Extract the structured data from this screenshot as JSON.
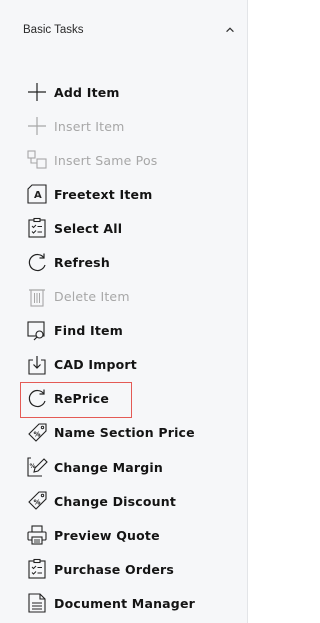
{
  "panel": {
    "title": "Basic Tasks",
    "collapse_icon": "chevron-up-icon"
  },
  "items": [
    {
      "label": "Add Item",
      "icon": "plus-icon",
      "enabled": true
    },
    {
      "label": "Insert Item",
      "icon": "plus-icon",
      "enabled": false
    },
    {
      "label": "Insert Same Pos",
      "icon": "insert-same-pos-icon",
      "enabled": false
    },
    {
      "label": "Freetext Item",
      "icon": "freetext-icon",
      "enabled": true
    },
    {
      "label": "Select All",
      "icon": "checklist-clipboard-icon",
      "enabled": true
    },
    {
      "label": "Refresh",
      "icon": "refresh-icon",
      "enabled": true
    },
    {
      "label": "Delete Item",
      "icon": "trash-icon",
      "enabled": false
    },
    {
      "label": "Find Item",
      "icon": "find-icon",
      "enabled": true
    },
    {
      "label": "CAD Import",
      "icon": "import-icon",
      "enabled": true
    },
    {
      "label": "RePrice",
      "icon": "refresh-icon",
      "enabled": true,
      "highlighted": true
    },
    {
      "label": "Name Section Price",
      "icon": "price-tag-icon",
      "enabled": true
    },
    {
      "label": "Change Margin",
      "icon": "edit-margin-icon",
      "enabled": true
    },
    {
      "label": "Change Discount",
      "icon": "price-tag-icon",
      "enabled": true
    },
    {
      "label": "Preview Quote",
      "icon": "printer-icon",
      "enabled": true
    },
    {
      "label": "Purchase Orders",
      "icon": "checklist-clipboard-icon",
      "enabled": true
    },
    {
      "label": "Document Manager",
      "icon": "document-icon",
      "enabled": true
    }
  ],
  "colors": {
    "highlight_border": "#e45a55",
    "disabled_text": "#a7a7a7",
    "text": "#141414"
  }
}
